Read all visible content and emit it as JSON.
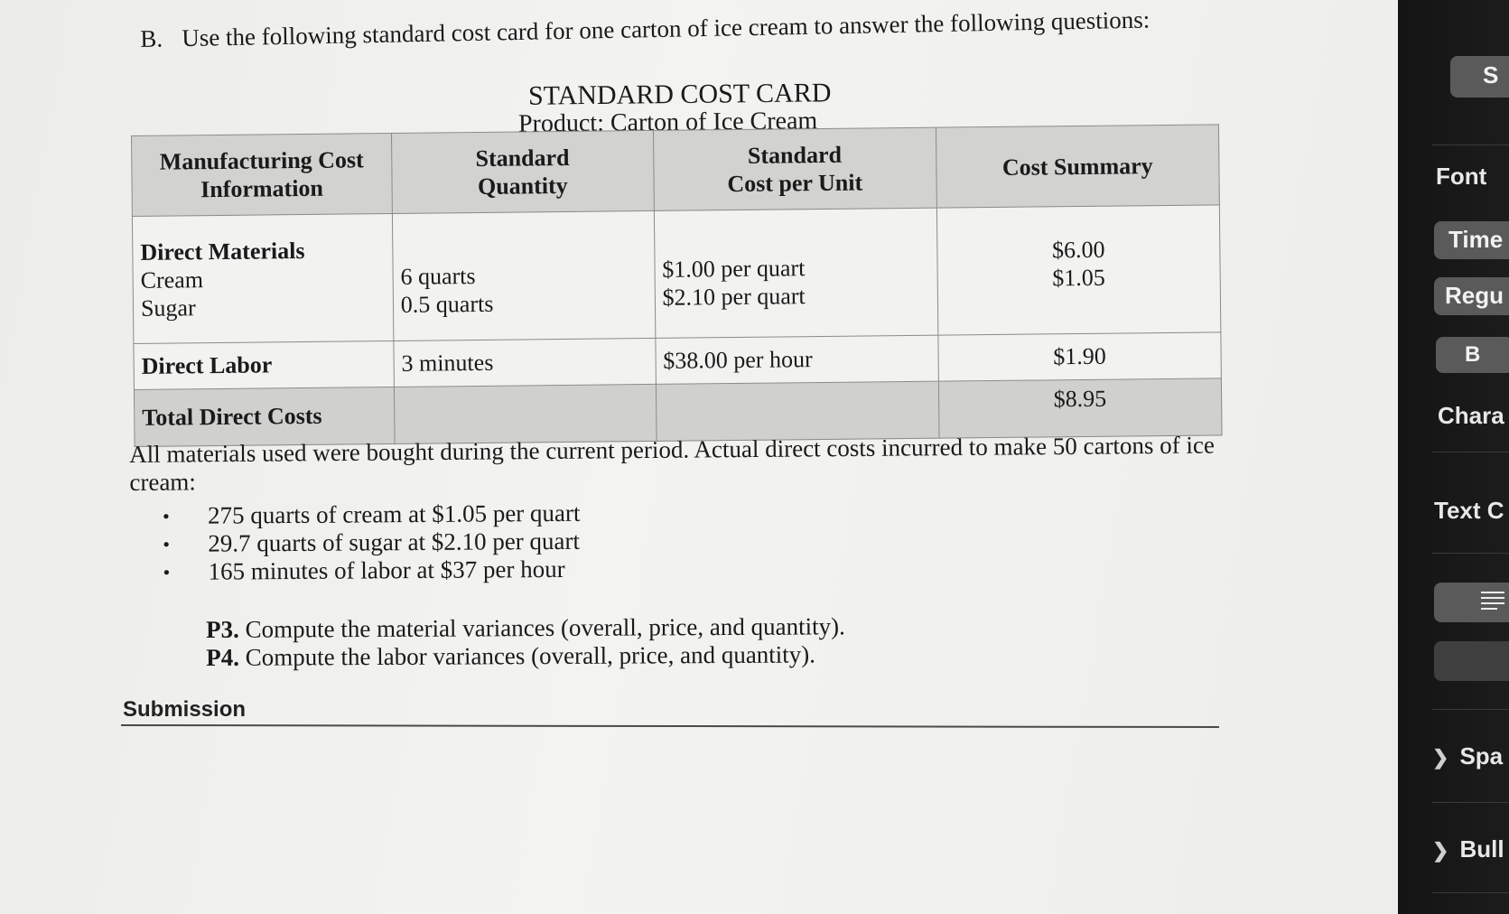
{
  "question": {
    "label": "B.",
    "text": "Use the following standard cost card for one carton of ice cream to answer the following questions:"
  },
  "card": {
    "title": "STANDARD COST CARD",
    "product": "Product: Carton of Ice Cream",
    "headers": {
      "col1_line1": "Manufacturing Cost",
      "col1_line2": "Information",
      "col2_line1": "Standard",
      "col2_line2": "Quantity",
      "col3_line1": "Standard",
      "col3_line2": "Cost per Unit",
      "col4": "Cost Summary"
    },
    "direct_materials": {
      "label": "Direct Materials",
      "items": [
        {
          "name": "Cream",
          "quantity": "6 quarts",
          "cost": "$1.00 per quart",
          "summary": "$6.00"
        },
        {
          "name": "Sugar",
          "quantity": "0.5 quarts",
          "cost": "$2.10 per quart",
          "summary": "$1.05"
        }
      ]
    },
    "direct_labor": {
      "label": "Direct Labor",
      "quantity": "3 minutes",
      "cost": "$38.00 per hour",
      "summary": "$1.90"
    },
    "total": {
      "label": "Total Direct Costs",
      "summary": "$8.95"
    }
  },
  "paragraph": "All materials used were bought during the current period.  Actual direct costs incurred to make 50 cartons of ice cream:",
  "bullets": [
    "275 quarts of cream at $1.05 per quart",
    "29.7 quarts of sugar at $2.10 per quart",
    "165 minutes of labor at $37 per hour"
  ],
  "problems": [
    {
      "label": "P3.",
      "text": "Compute the material variances (overall, price, and quantity)."
    },
    {
      "label": "P4.",
      "text": "Compute the labor variances (overall, price, and quantity)."
    }
  ],
  "submission": "Submission",
  "panel": {
    "top_button": "S",
    "font_label": "Font",
    "font_family": "Time",
    "font_style": "Regu",
    "bold": "B",
    "character_label": "Chara",
    "text_color_label": "Text C",
    "align_icon": "align-lines-icon",
    "spacing": "Spa",
    "bullets": "Bull"
  }
}
